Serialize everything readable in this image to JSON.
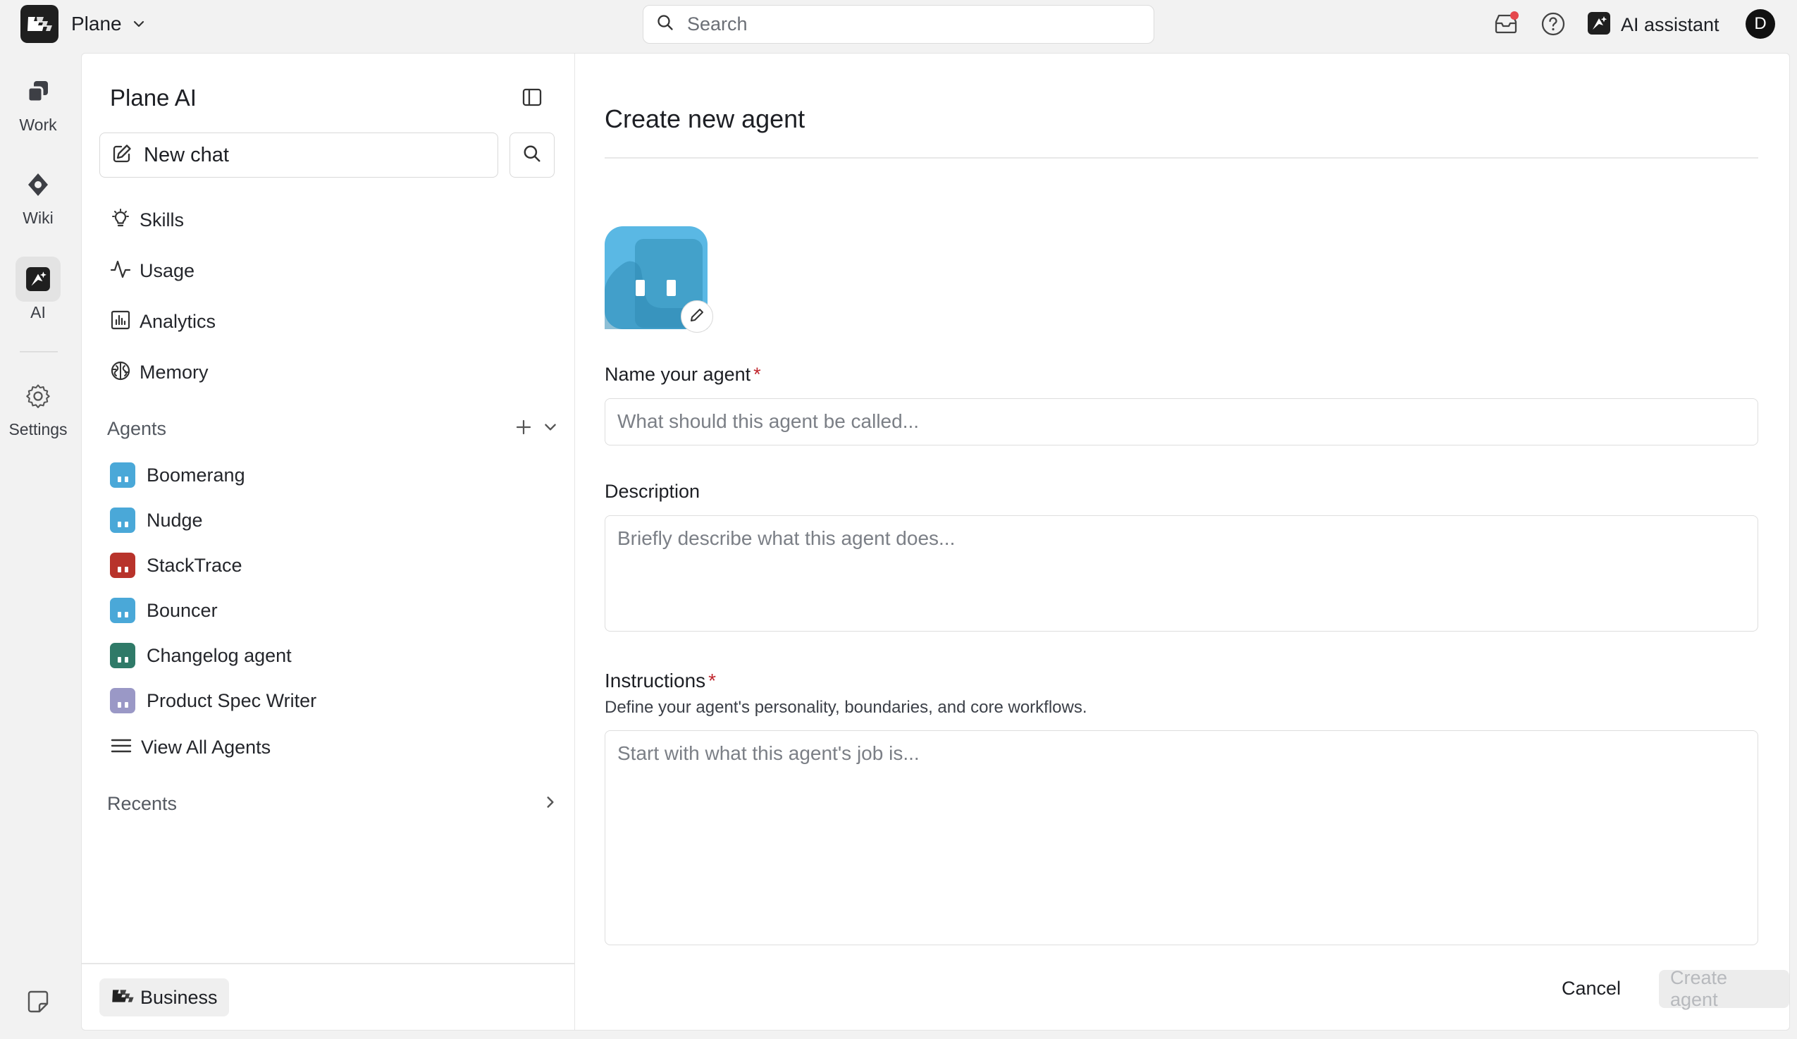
{
  "topbar": {
    "workspace_name": "Plane",
    "search_placeholder": "Search",
    "assistant_label": "AI assistant",
    "avatar_initial": "D"
  },
  "rail": {
    "items": [
      {
        "label": "Work",
        "icon": "work-icon"
      },
      {
        "label": "Wiki",
        "icon": "wiki-icon"
      },
      {
        "label": "AI",
        "icon": "ai-icon",
        "active": true
      },
      {
        "label": "Settings",
        "icon": "gear-icon"
      }
    ]
  },
  "sidebar": {
    "title": "Plane AI",
    "new_chat_label": "New chat",
    "nav": [
      {
        "label": "Skills",
        "icon": "lightbulb-icon"
      },
      {
        "label": "Usage",
        "icon": "activity-icon"
      },
      {
        "label": "Analytics",
        "icon": "analytics-icon"
      },
      {
        "label": "Memory",
        "icon": "brain-icon"
      }
    ],
    "agents_heading": "Agents",
    "agents": [
      {
        "name": "Boomerang",
        "color": "#4aa8d8"
      },
      {
        "name": "Nudge",
        "color": "#4aa8d8"
      },
      {
        "name": "StackTrace",
        "color": "#b8332b"
      },
      {
        "name": "Bouncer",
        "color": "#4aa8d8"
      },
      {
        "name": "Changelog agent",
        "color": "#2f7a68"
      },
      {
        "name": "Product Spec Writer",
        "color": "#9a98c6"
      }
    ],
    "view_all_label": "View All Agents",
    "recents_heading": "Recents",
    "plan_label": "Business"
  },
  "form": {
    "title": "Create new agent",
    "name_label": "Name your agent",
    "required_mark": "*",
    "name_placeholder": "What should this agent be called...",
    "description_label": "Description",
    "description_placeholder": "Briefly describe what this agent does...",
    "instructions_label": "Instructions",
    "instructions_helper": "Define your agent's personality, boundaries, and core workflows.",
    "instructions_placeholder": "Start with what this agent's job is...",
    "cancel_label": "Cancel",
    "create_label": "Create agent"
  }
}
